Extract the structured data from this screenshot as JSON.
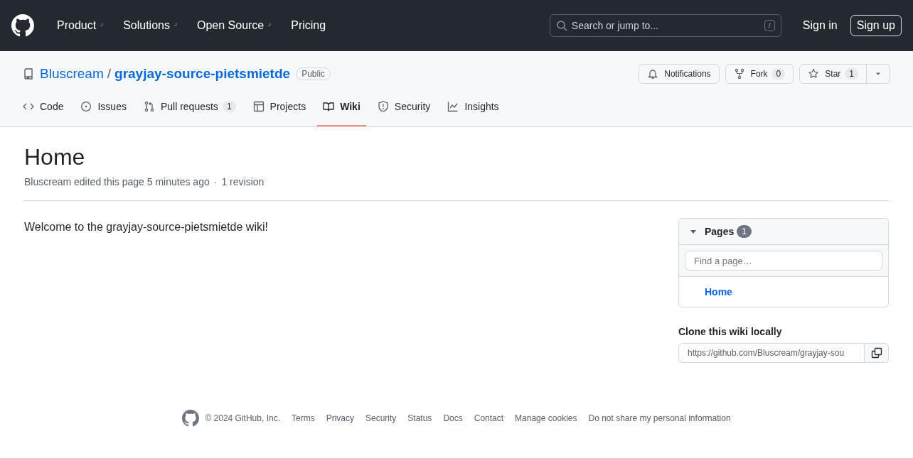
{
  "header": {
    "nav": [
      {
        "label": "Product",
        "dropdown": true
      },
      {
        "label": "Solutions",
        "dropdown": true
      },
      {
        "label": "Open Source",
        "dropdown": true
      },
      {
        "label": "Pricing",
        "dropdown": false
      }
    ],
    "search": {
      "placeholder": "Search or jump to...",
      "shortcut": "/"
    },
    "sign_in": "Sign in",
    "sign_up": "Sign up"
  },
  "repo": {
    "owner": "Bluscream",
    "separator": "/",
    "name": "grayjay-source-pietsmietde",
    "visibility": "Public",
    "actions": [
      {
        "label": "Notifications"
      },
      {
        "label": "Fork",
        "count": "0"
      },
      {
        "label": "Star",
        "count": "1"
      }
    ],
    "tabs": [
      {
        "label": "Code",
        "selected": false
      },
      {
        "label": "Issues",
        "selected": false
      },
      {
        "label": "Pull requests",
        "count": "1",
        "selected": false
      },
      {
        "label": "Projects",
        "selected": false
      },
      {
        "label": "Wiki",
        "selected": true
      },
      {
        "label": "Security",
        "selected": false
      },
      {
        "label": "Insights",
        "selected": false
      }
    ]
  },
  "page": {
    "title": "Home",
    "meta": "Bluscream edited this page 5 minutes ago",
    "meta_separator": "·",
    "revisions": "1 revision",
    "body": "Welcome to the grayjay-source-pietsmietde wiki!"
  },
  "sidebar": {
    "pages_title": "Pages",
    "pages_count": "1",
    "expanded": true,
    "filter_placeholder": "Find a page…",
    "pages": [
      {
        "label": "Home"
      }
    ],
    "clone_title": "Clone this wiki locally",
    "clone_url": "https://github.com/Bluscream/grayjay-sou"
  },
  "footer": {
    "copyright": "© 2024 GitHub, Inc.",
    "links": [
      "Terms",
      "Privacy",
      "Security",
      "Status",
      "Docs",
      "Contact",
      "Manage cookies",
      "Do not share my personal information"
    ]
  }
}
